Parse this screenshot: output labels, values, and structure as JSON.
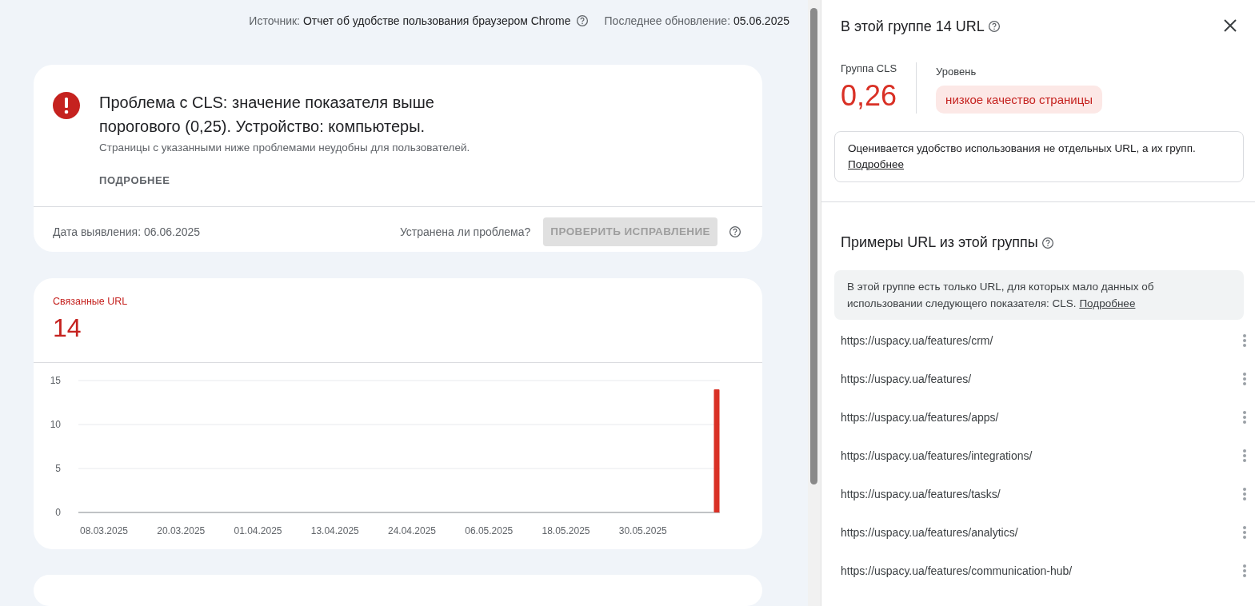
{
  "header": {
    "source_label": "Источник:",
    "source_value": "Отчет об удобстве пользования браузером Chrome",
    "updated_label": "Последнее обновление:",
    "updated_value": "05.06.2025"
  },
  "issue": {
    "title": "Проблема с CLS: значение показателя выше порогового (0,25). Устройство: компьютеры.",
    "description": "Страницы с указанными ниже проблемами неудобны для пользователей.",
    "more_link": "ПОДРОБНЕЕ",
    "detected": "Дата выявления: 06.06.2025",
    "fixed_question": "Устранена ли проблема?",
    "validate_button": {
      "label": "ПРОВЕРИТЬ ИСПРАВЛЕНИЕ",
      "disabled": true
    }
  },
  "related": {
    "label": "Связанные URL",
    "count": "14",
    "chart_data": {
      "type": "bar",
      "ylim": [
        0,
        15
      ],
      "yticks": [
        0,
        5,
        10,
        15
      ],
      "categories": [
        "08.03.2025",
        "20.03.2025",
        "01.04.2025",
        "13.04.2025",
        "24.04.2025",
        "06.05.2025",
        "18.05.2025",
        "30.05.2025",
        null
      ],
      "series": [
        {
          "color": "#d93025",
          "values": [
            0,
            0,
            0,
            0,
            0,
            0,
            0,
            0,
            14
          ]
        }
      ]
    }
  },
  "panel": {
    "title": "В этой группе 14 URL",
    "metric_label": "Группа CLS",
    "metric_value": "0,26",
    "level_label": "Уровень",
    "level_badge": "низкое качество страницы",
    "info_text": "Оценивается удобство использования не отдельных URL, а их групп.",
    "info_link": "Подробнее",
    "examples_title": "Примеры URL из этой группы",
    "notice_text": "В этой группе есть только URL, для которых мало данных об использовании следующего показателя: CLS.",
    "notice_link": "Подробнее",
    "urls": [
      "https://uspacy.ua/features/crm/",
      "https://uspacy.ua/features/",
      "https://uspacy.ua/features/apps/",
      "https://uspacy.ua/features/integrations/",
      "https://uspacy.ua/features/tasks/",
      "https://uspacy.ua/features/analytics/",
      "https://uspacy.ua/features/communication-hub/"
    ]
  }
}
